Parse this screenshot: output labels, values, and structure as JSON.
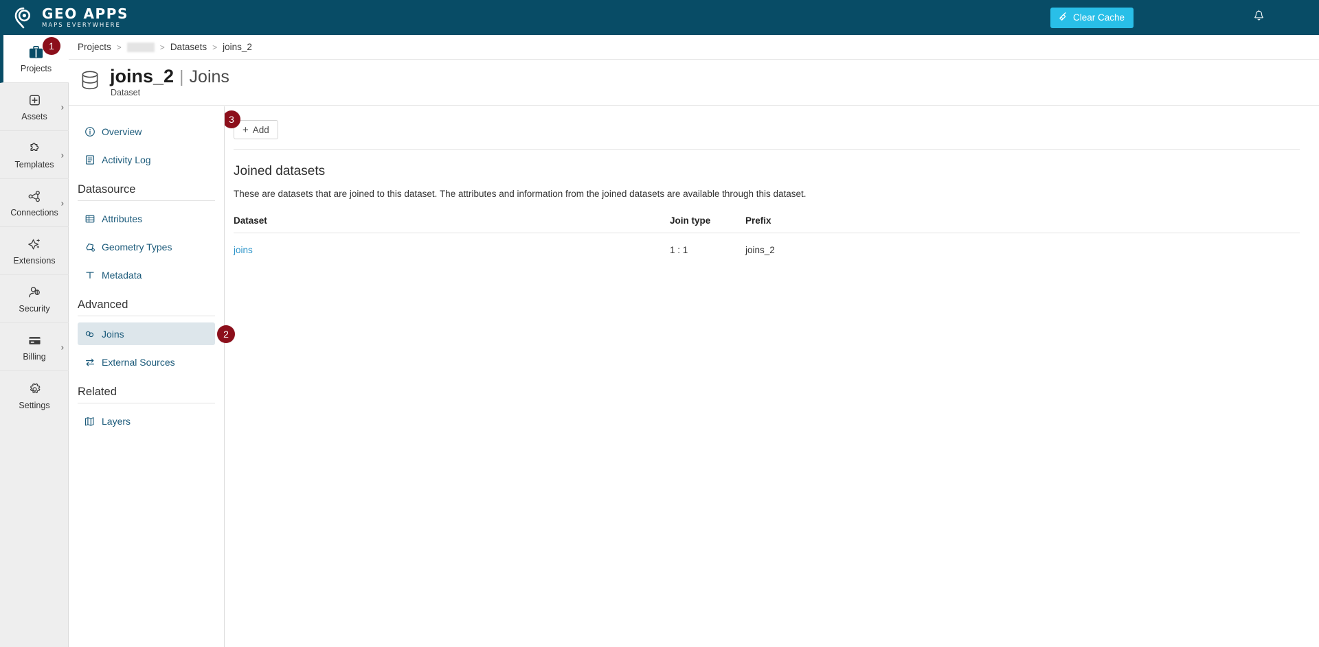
{
  "header": {
    "brand_name": "GEO APPS",
    "brand_tagline": "MAPS EVERYWHERE",
    "brand_logo_icon": "map-pin-logo-icon",
    "clear_cache_label": "Clear Cache",
    "clear_cache_icon": "broom-icon",
    "notifications_icon": "bell-icon",
    "background_color": "#084c66",
    "accent_color": "#29bfe8"
  },
  "rail": {
    "items": [
      {
        "label": "Projects",
        "icon": "briefcase-icon",
        "active": true,
        "expandable": false
      },
      {
        "label": "Assets",
        "icon": "plus-box-icon",
        "active": false,
        "expandable": true
      },
      {
        "label": "Templates",
        "icon": "puzzle-icon",
        "active": false,
        "expandable": true
      },
      {
        "label": "Connections",
        "icon": "nodes-icon",
        "active": false,
        "expandable": true
      },
      {
        "label": "Extensions",
        "icon": "sparkle-plus-icon",
        "active": false,
        "expandable": false
      },
      {
        "label": "Security",
        "icon": "user-shield-icon",
        "active": false,
        "expandable": false
      },
      {
        "label": "Billing",
        "icon": "credit-card-icon",
        "active": false,
        "expandable": true
      },
      {
        "label": "Settings",
        "icon": "gear-icon",
        "active": false,
        "expandable": false
      }
    ]
  },
  "breadcrumb": {
    "separator": ">",
    "items": [
      {
        "label": "Projects",
        "redacted": false
      },
      {
        "label": "",
        "redacted": true
      },
      {
        "label": "Datasets",
        "redacted": false
      },
      {
        "label": "joins_2",
        "redacted": false
      }
    ]
  },
  "page_title": {
    "icon": "database-icon",
    "name": "joins_2",
    "divider": "|",
    "section": "Joins",
    "kind": "Dataset"
  },
  "subnav": {
    "top_items": [
      {
        "label": "Overview",
        "icon": "info-circle-icon",
        "selected": false
      },
      {
        "label": "Activity Log",
        "icon": "list-doc-icon",
        "selected": false
      }
    ],
    "groups": [
      {
        "title": "Datasource",
        "items": [
          {
            "label": "Attributes",
            "icon": "table-icon",
            "selected": false
          },
          {
            "label": "Geometry Types",
            "icon": "geometry-icon",
            "selected": false
          },
          {
            "label": "Metadata",
            "icon": "text-t-icon",
            "selected": false
          }
        ]
      },
      {
        "title": "Advanced",
        "items": [
          {
            "label": "Joins",
            "icon": "link-chain-icon",
            "selected": true
          },
          {
            "label": "External Sources",
            "icon": "exchange-icon",
            "selected": false
          }
        ]
      },
      {
        "title": "Related",
        "items": [
          {
            "label": "Layers",
            "icon": "layers-map-icon",
            "selected": false
          }
        ]
      }
    ]
  },
  "main": {
    "add_button_label": "Add",
    "add_button_icon": "plus-icon",
    "section_title": "Joined datasets",
    "section_description": "These are datasets that are joined to this dataset. The attributes and information from the joined datasets are available through this dataset.",
    "table": {
      "columns": [
        "Dataset",
        "Join type",
        "Prefix"
      ],
      "rows": [
        {
          "dataset": "joins",
          "join_type": "1 : 1",
          "prefix": "joins_2"
        }
      ]
    }
  },
  "callouts": [
    {
      "number": "1",
      "target": "rail-item-projects"
    },
    {
      "number": "2",
      "target": "subnav-item-joins"
    },
    {
      "number": "3",
      "target": "add-button"
    }
  ],
  "colors": {
    "callout_badge": "#8c0f1b",
    "link": "#2a93c9",
    "nav_link": "#1b5a7a",
    "selected_nav_bg": "#dde6eb"
  }
}
